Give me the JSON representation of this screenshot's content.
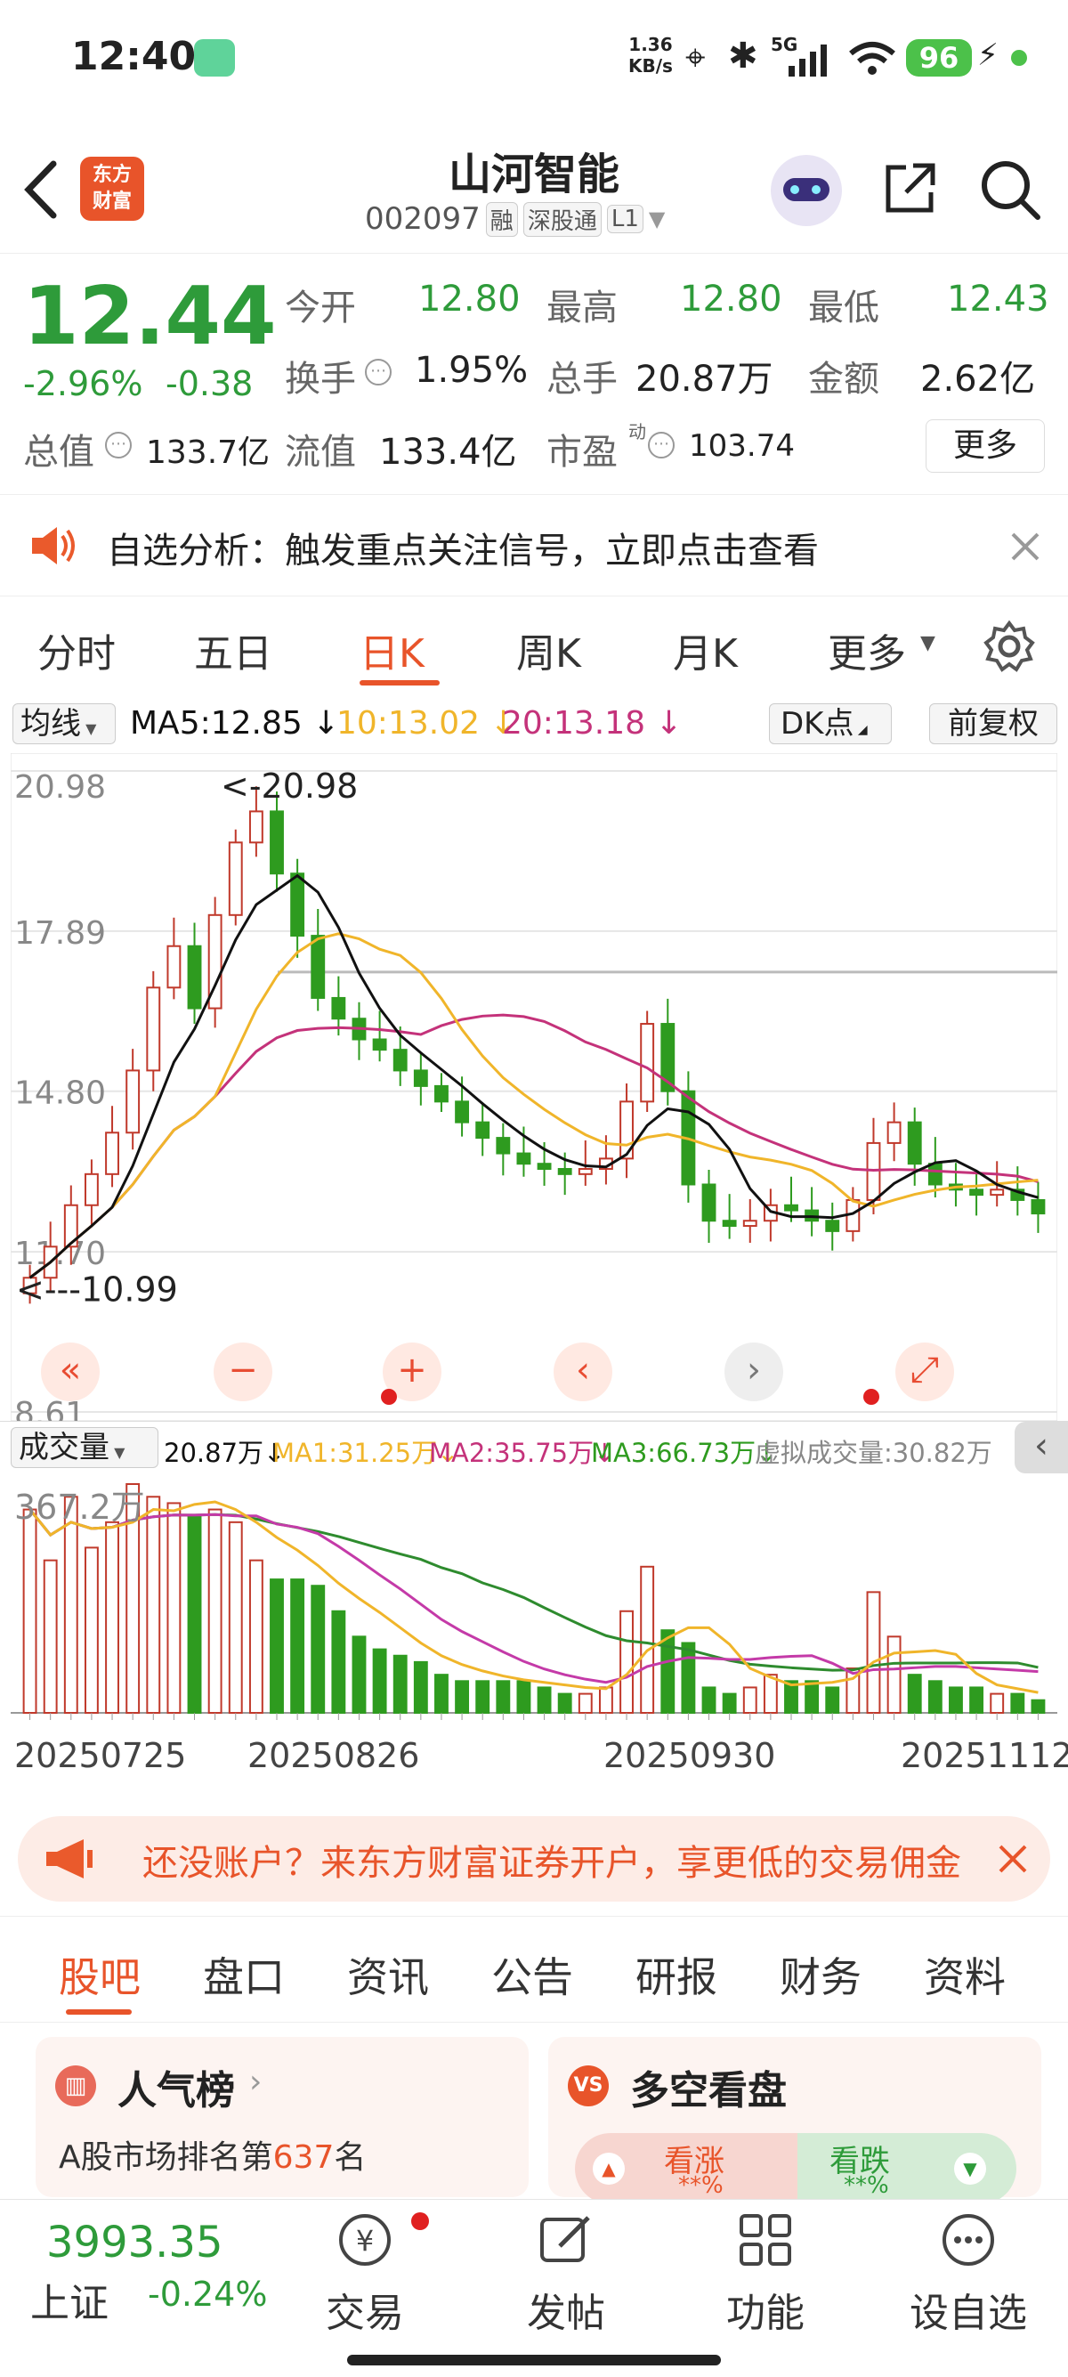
{
  "status_bar": {
    "time": "12:40",
    "net_speed_top": "1.36",
    "net_speed_bottom": "KB/s",
    "signal": "5G",
    "battery": "96"
  },
  "header": {
    "back_icon": "back-arrow-icon",
    "logo_top": "东方",
    "logo_bottom": "财富",
    "title": "山河智能",
    "code": "002097",
    "tags": [
      "融",
      "深股通",
      "L1"
    ]
  },
  "quote": {
    "price": "12.44",
    "change_pct": "-2.96%",
    "change_abs": "-0.38",
    "open_label": "今开",
    "open": "12.80",
    "high_label": "最高",
    "high": "12.80",
    "low_label": "最低",
    "low": "12.43",
    "turnover_label": "换手",
    "turnover": "1.95%",
    "volume_label": "总手",
    "volume": "20.87万",
    "amount_label": "金额",
    "amount": "2.62亿",
    "mktcap_label": "总值",
    "mktcap": "133.7亿",
    "float_label": "流值",
    "float": "133.4亿",
    "pe_label": "市盈",
    "pe_sup": "动",
    "pe": "103.74",
    "more": "更多"
  },
  "notice": {
    "text": "自选分析：触发重点关注信号，立即点击查看"
  },
  "period_tabs": {
    "items": [
      "分时",
      "五日",
      "日K",
      "周K",
      "月K",
      "更多"
    ],
    "active": "日K"
  },
  "kline": {
    "ma_select": "均线",
    "ma5": "MA5:12.85",
    "ma10": "10:13.02",
    "ma20": "20:13.18",
    "dk": "DK点",
    "adjust": "前复权",
    "y_labels": [
      "20.98",
      "17.89",
      "14.80",
      "11.70",
      "8.61"
    ],
    "max_marker": "<-20.98",
    "min_marker": "<---10.99",
    "colors": {
      "up": "#c0392b",
      "down": "#2e9b1f",
      "ma5": "#111111",
      "ma10": "#f0b52a",
      "ma20": "#c4327a"
    }
  },
  "volume": {
    "select": "成交量",
    "vol": "20.87万",
    "ma1": "MA1:31.25万",
    "ma2": "MA2:35.75万",
    "ma3": "MA3:66.73万",
    "virtual": "虚拟成交量:30.82万",
    "max_label": "367.2万"
  },
  "x_dates": [
    "20250725",
    "20250826",
    "20250930",
    "20251112"
  ],
  "promo": {
    "text": "还没账户？来东方财富证券开户，享更低的交易佣金"
  },
  "info_tabs": {
    "items": [
      "股吧",
      "盘口",
      "资讯",
      "公告",
      "研报",
      "财务",
      "资料"
    ],
    "active": "股吧"
  },
  "cards": {
    "popular_title": "人气榜",
    "popular_rank_prefix": "A股市场排名第",
    "popular_rank": "637",
    "popular_rank_suffix": "名",
    "vs_title": "多空看盘",
    "bull": "看涨",
    "bear": "看跌",
    "bull_pct": "**%",
    "bear_pct": "**%"
  },
  "bottom_bar": {
    "index_value": "3993.35",
    "index_name": "上证",
    "index_change": "-0.24%",
    "items": [
      "交易",
      "发帖",
      "功能",
      "设自选"
    ]
  },
  "chart_data": {
    "type": "candlestick",
    "y_range": [
      8.61,
      20.98
    ],
    "x_labels": [
      "20250725",
      "20250826",
      "20250930",
      "20251112"
    ],
    "candles_close_approx": [
      11.2,
      11.8,
      12.6,
      13.2,
      14.0,
      15.2,
      16.8,
      17.6,
      16.4,
      18.2,
      19.6,
      20.2,
      19.0,
      17.8,
      16.6,
      16.2,
      15.8,
      15.6,
      15.2,
      14.9,
      14.6,
      14.2,
      13.9,
      13.6,
      13.4,
      13.3,
      13.2,
      13.3,
      13.5,
      14.6,
      16.1,
      14.8,
      13.0,
      12.3,
      12.2,
      12.3,
      12.6,
      12.5,
      12.3,
      12.1,
      12.7,
      13.8,
      14.2,
      13.4,
      13.0,
      12.9,
      12.8,
      12.9,
      12.7,
      12.44
    ],
    "series": [
      {
        "name": "MA5",
        "value": "12.85"
      },
      {
        "name": "MA10",
        "value": "13.02"
      },
      {
        "name": "MA20",
        "value": "13.18"
      }
    ]
  }
}
